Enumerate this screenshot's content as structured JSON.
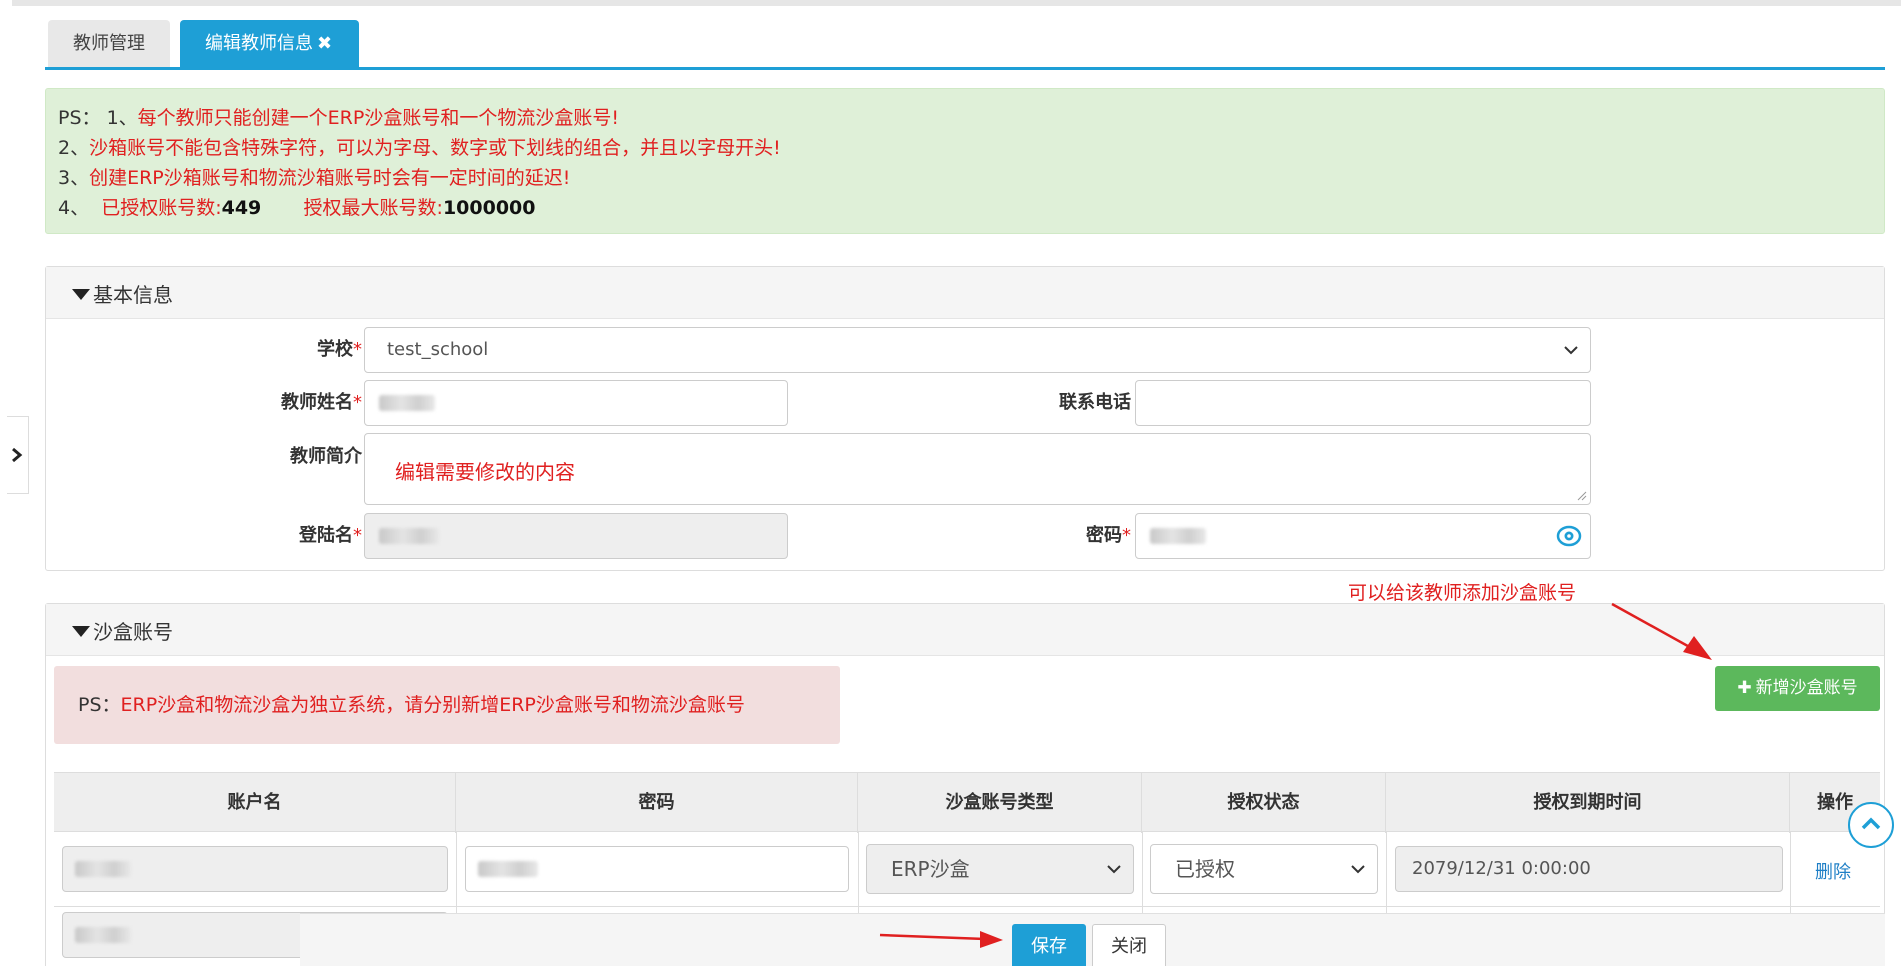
{
  "tabs": [
    {
      "label": "教师管理"
    },
    {
      "label": "编辑教师信息",
      "close": "✖"
    }
  ],
  "notice": {
    "line1_prefix": "PS：",
    "line1_num": "1、",
    "line1_text": "每个教师只能创建一个ERP沙盒账号和一个物流沙盒账号!",
    "line2_num": "2、",
    "line2_text": "沙箱账号不能包含特殊字符，可以为字母、数字或下划线的组合，并且以字母开头!",
    "line3_num": "3、",
    "line3_text": "创建ERP沙箱账号和物流沙箱账号时会有一定时间的延迟!",
    "line4_num": "4、",
    "authorized_label": "已授权账号数:",
    "authorized_value": "449",
    "max_label": "授权最大账号数:",
    "max_value": "1000000"
  },
  "basic_info": {
    "title": "基本信息",
    "school_label": "学校",
    "school_value": "test_school",
    "teacher_name_label": "教师姓名",
    "phone_label": "联系电话",
    "intro_label": "教师简介",
    "intro_value": "编辑需要修改的内容",
    "login_label": "登陆名",
    "password_label": "密码",
    "required_mark": "*"
  },
  "sandbox": {
    "title": "沙盒账号",
    "annotation": "可以给该教师添加沙盒账号",
    "ps_prefix": "PS：",
    "ps_text": "ERP沙盒和物流沙盒为独立系统，请分别新增ERP沙盒账号和物流沙盒账号",
    "add_button": "新增沙盒账号",
    "columns": [
      "账户名",
      "密码",
      "沙盒账号类型",
      "授权状态",
      "授权到期时间",
      "操作"
    ],
    "rows": [
      {
        "type": "ERP沙盒",
        "status": "已授权",
        "expiry": "2079/12/31 0:00:00",
        "action": "删除"
      }
    ]
  },
  "footer": {
    "save": "保存",
    "close": "关闭"
  },
  "colors": {
    "accent": "#1e9fd6",
    "success": "#5cb85c",
    "danger_text": "#e02020",
    "notice_bg": "#dff0d8",
    "alert_bg": "#f2dede"
  }
}
